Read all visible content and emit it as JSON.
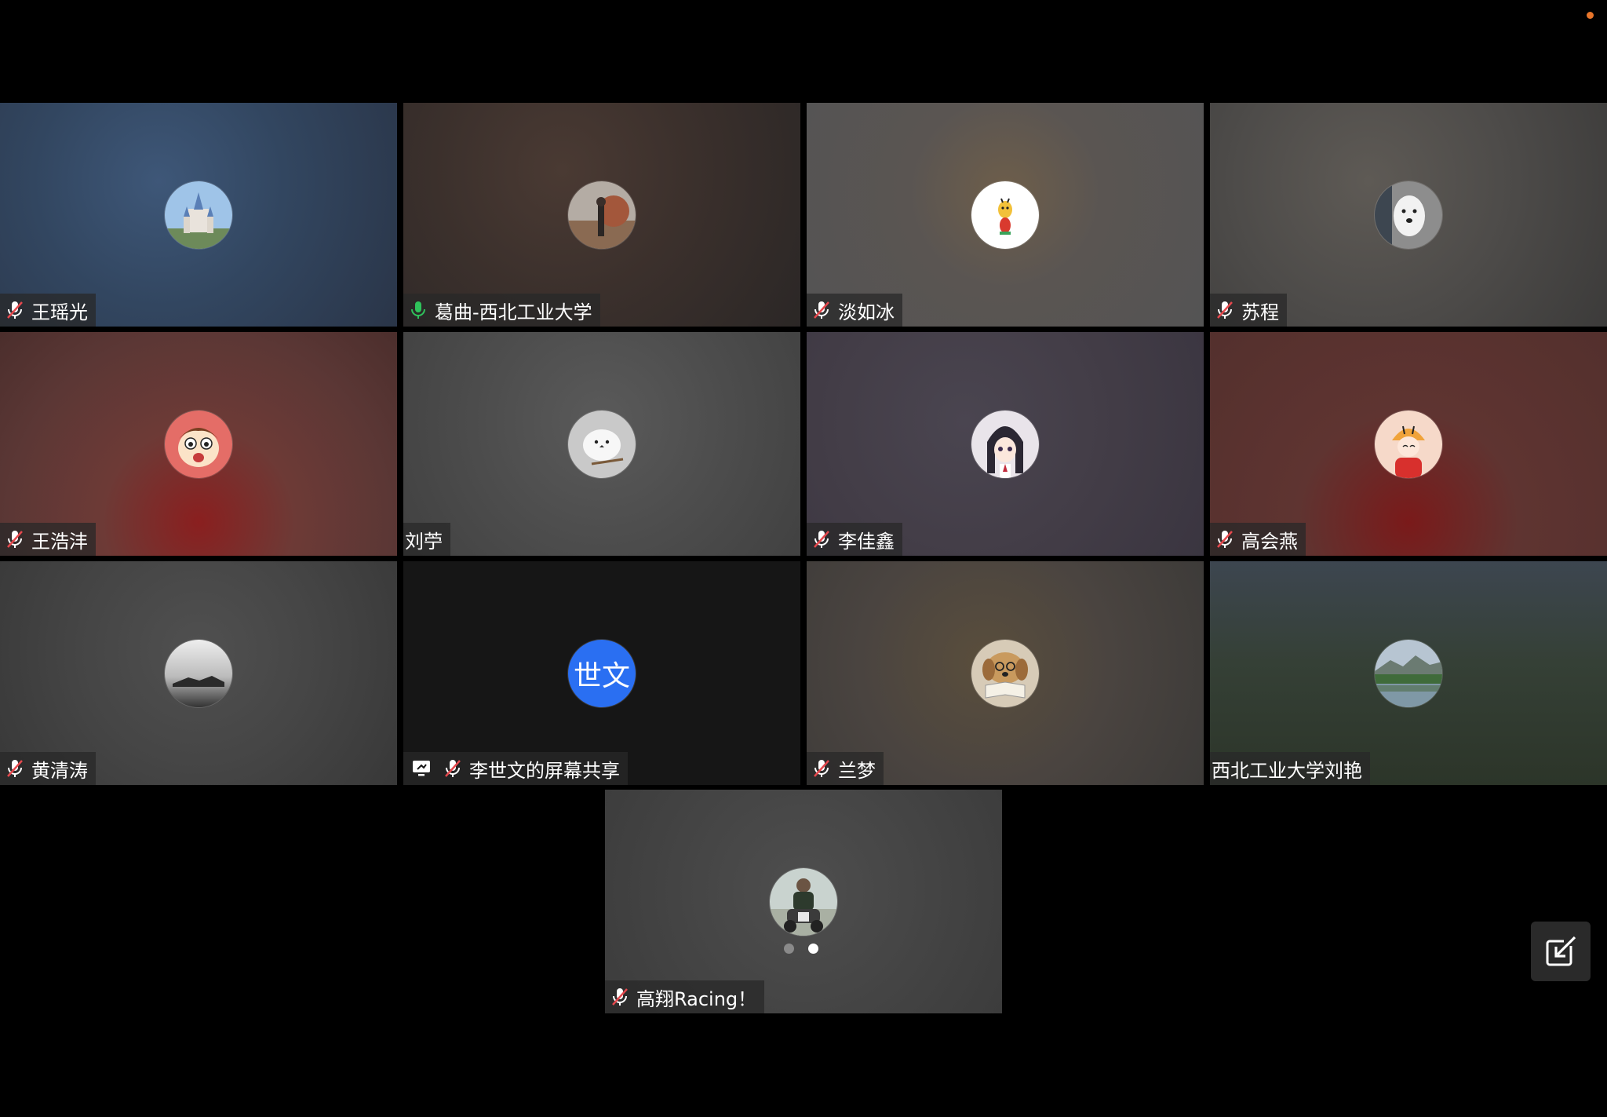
{
  "colors": {
    "background": "#000000",
    "nametag_bg": "rgba(40,40,40,0.75)",
    "mic_muted": "#ffffff",
    "mic_muted_slash": "#e5484d",
    "mic_active": "#2fc25b",
    "text_avatar_bg": "#2a6ff2",
    "notify_dot": "#e8752a",
    "page_dot_inactive": "#8a8a8a",
    "page_dot_active": "#ffffff"
  },
  "participants": [
    {
      "name": "王瑶光",
      "mic": "muted",
      "avatar_icon": "castle-avatar-icon"
    },
    {
      "name": "葛曲-西北工业大学",
      "mic": "active",
      "avatar_icon": "autumn-figure-avatar-icon"
    },
    {
      "name": "淡如冰",
      "mic": "muted",
      "avatar_icon": "cartoon-giraffe-avatar-icon"
    },
    {
      "name": "苏程",
      "mic": "muted",
      "avatar_icon": "white-dog-avatar-icon"
    },
    {
      "name": "王浩沣",
      "mic": "muted",
      "avatar_icon": "cartoon-boy-face-avatar-icon"
    },
    {
      "name": "刘苧",
      "mic": "none",
      "avatar_icon": "white-bird-avatar-icon"
    },
    {
      "name": "李佳鑫",
      "mic": "muted",
      "avatar_icon": "anime-girl-avatar-icon"
    },
    {
      "name": "高会燕",
      "mic": "muted",
      "avatar_icon": "tiger-hat-child-avatar-icon"
    },
    {
      "name": "黄清涛",
      "mic": "muted",
      "avatar_icon": "grayscale-landscape-avatar-icon"
    },
    {
      "name": "李世文的屏幕共享",
      "mic": "muted",
      "screen_share": true,
      "avatar_text": "世文"
    },
    {
      "name": "兰梦",
      "mic": "muted",
      "avatar_icon": "dog-reading-avatar-icon"
    },
    {
      "name": "西北工业大学刘艳",
      "mic": "none",
      "avatar_icon": "lake-landscape-avatar-icon"
    },
    {
      "name": "高翔Racing！",
      "mic": "muted",
      "avatar_icon": "motorcycle-rider-avatar-icon"
    }
  ],
  "pagination": {
    "total": 2,
    "current": 2
  },
  "fullscreen_button": {
    "icon": "exit-fullscreen-icon"
  }
}
